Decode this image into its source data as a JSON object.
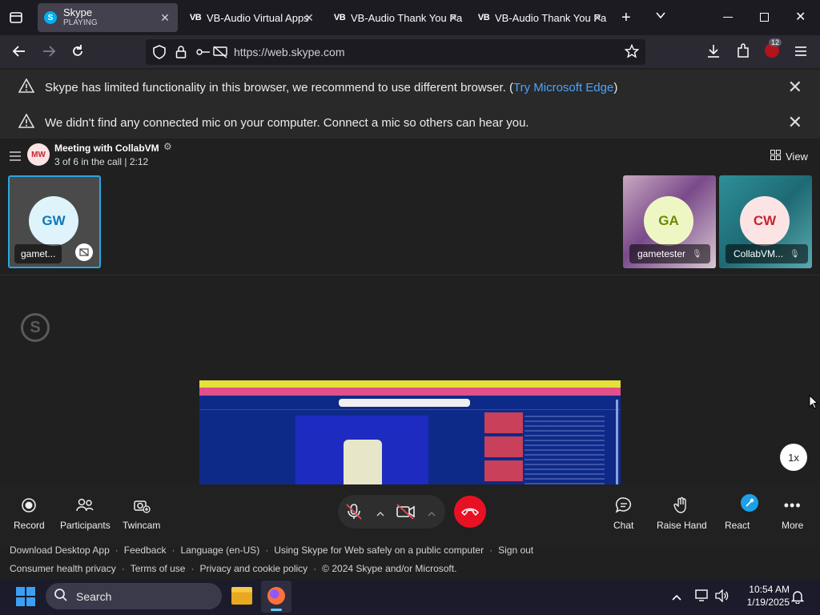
{
  "browser": {
    "tabs": [
      {
        "title": "Skype",
        "subtitle": "PLAYING",
        "favicon": "skype-icon"
      },
      {
        "title": "VB-Audio Virtual Apps",
        "favicon": "vb-audio-icon"
      },
      {
        "title": "VB-Audio Thank You Pa",
        "favicon": "vb-audio-icon"
      },
      {
        "title": "VB-Audio Thank You Pa",
        "favicon": "vb-audio-icon"
      }
    ],
    "url": "https://web.skype.com",
    "extension_badge": "12"
  },
  "notices": [
    {
      "text": "Skype has limited functionality in this browser, we recommend to use different browser. (",
      "link": "Try Microsoft Edge",
      "suffix": ")"
    },
    {
      "text": "We didn't find any connected mic on your computer. Connect a mic so others can hear you."
    }
  ],
  "call": {
    "initials": "MW",
    "title": "Meeting with CollabVM",
    "status": "3 of 6 in the call | 2:12",
    "view_label": "View",
    "speed_label": "1x"
  },
  "participants": [
    {
      "initials": "GW",
      "name": "gamet...",
      "color": "#0a7ab8",
      "bg": "#dff3fb"
    },
    {
      "initials": "GA",
      "name": "gametester",
      "color": "#6b8a00",
      "bg": "#eef7c4"
    },
    {
      "initials": "CW",
      "name": "CollabVM...",
      "color": "#c4262e",
      "bg": "#fde4e4"
    }
  ],
  "controls": {
    "record": "Record",
    "participants": "Participants",
    "twincam": "Twincam",
    "chat": "Chat",
    "raise_hand": "Raise Hand",
    "react": "React",
    "more": "More"
  },
  "footer": {
    "line1": [
      "Download Desktop App",
      "Feedback",
      "Language (en-US)",
      "Using Skype for Web safely on a public computer",
      "Sign out"
    ],
    "line2": [
      "Consumer health privacy",
      "Terms of use",
      "Privacy and cookie policy",
      "© 2024 Skype and/or Microsoft."
    ]
  },
  "taskbar": {
    "search_placeholder": "Search",
    "time": "10:54 AM",
    "date": "1/19/2025"
  },
  "colors": {
    "skype_blue": "#00aff0",
    "hangup_red": "#e81123",
    "link_blue": "#4da3ff"
  }
}
